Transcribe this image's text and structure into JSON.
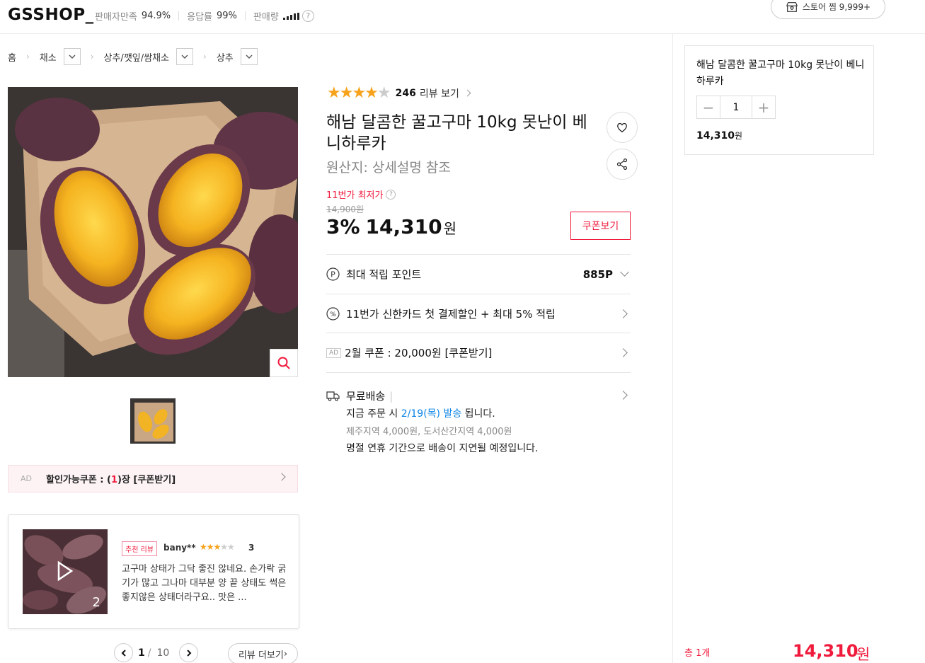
{
  "header": {
    "logo": "GSSHOP_",
    "stats": [
      {
        "label": "판매자만족",
        "value": "94.9%"
      },
      {
        "label": "응답률",
        "value": "99%"
      },
      {
        "label": "판매량",
        "value": ""
      }
    ],
    "store_fav": "스토어 찜 9,999+"
  },
  "breadcrumb": [
    "홈",
    "채소",
    "상추/깻잎/쌈채소",
    "상추"
  ],
  "gallery": {
    "coupon_ad": "AD",
    "coupon_text_prefix": "할인가능쿠폰 : (",
    "coupon_count": "1",
    "coupon_text_suffix": ")장 [쿠폰받기]"
  },
  "review_card": {
    "badge": "추천 리뷰",
    "user": "bany**",
    "score": "3",
    "media_count": "2",
    "text": "고구마 상태가 그닥 좋진 않네요. 손가락 굵기가 많고 그나마 대부분 양 끝 상태도 썩은 좋지않은 상태더라구요.. 맛은 ..."
  },
  "pager": {
    "current": "1",
    "slash": "/",
    "total": "10",
    "more": "리뷰 더보기 "
  },
  "product": {
    "rating": 4,
    "review_total": "246",
    "review_link": "리뷰 보기",
    "title": "해남 달콤한 꿀고구마 10kg 못난이 베니하루카",
    "origin": "원산지:  상세설명 참조",
    "lowest_label": "11번가 최저가",
    "original_price": "14,900원",
    "discount": "3%",
    "price": "14,310",
    "won": "원",
    "coupon_btn": "쿠폰보기"
  },
  "rows": {
    "points_label": "최대 적립 포인트",
    "points_value": "885P",
    "card_label": "11번가 신한카드 첫 결제할인 + 최대 5% 적립",
    "ad_tag": "AD",
    "coupon_label": "2월 쿠폰 : 20,000원 [쿠폰받기]"
  },
  "shipping": {
    "title": "무료배송",
    "bar": "|",
    "line1_prefix": "지금 주문 시 ",
    "line1_date": "2/19(목) 발송",
    "line1_suffix": " 됩니다.",
    "line2": "제주지역 4,000원, 도서산간지역 4,000원",
    "line3": "명절 연휴 기간으로 배송이 지연될 예정입니다."
  },
  "side": {
    "title": "해남 달콤한 꿀고구마 10kg 못난이 베니하루카",
    "qty": "1",
    "price": "14,310",
    "won": "원",
    "total_label": "총 1개",
    "total_price": "14,310",
    "total_won": "원"
  },
  "colors": {
    "accent": "#f01a3c",
    "star": "#f7a21b",
    "link": "#0b83e6"
  }
}
